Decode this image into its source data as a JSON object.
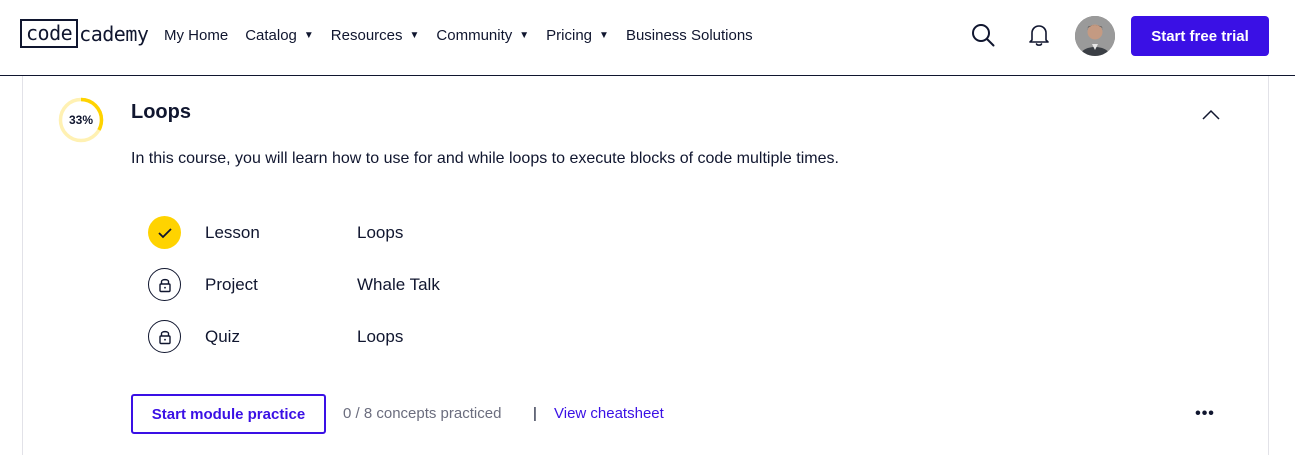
{
  "header": {
    "logo": {
      "part1": "code",
      "part2": "cademy"
    },
    "nav": [
      {
        "label": "My Home",
        "dropdown": false
      },
      {
        "label": "Catalog",
        "dropdown": true
      },
      {
        "label": "Resources",
        "dropdown": true
      },
      {
        "label": "Community",
        "dropdown": true
      },
      {
        "label": "Pricing",
        "dropdown": true
      },
      {
        "label": "Business Solutions",
        "dropdown": false
      }
    ],
    "icons": {
      "search": "search-icon",
      "notifications": "bell-icon"
    },
    "trial_label": "Start free trial"
  },
  "module": {
    "progress_label": "33%",
    "progress_fraction": 0.33,
    "title": "Loops",
    "description": "In this course, you will learn how to use for and while loops to execute blocks of code multiple times.",
    "items": [
      {
        "type": "Lesson",
        "name": "Loops",
        "status": "completed"
      },
      {
        "type": "Project",
        "name": "Whale Talk",
        "status": "locked"
      },
      {
        "type": "Quiz",
        "name": "Loops",
        "status": "locked"
      }
    ],
    "practice_label": "Start module practice",
    "concepts_text": "0 / 8 concepts practiced",
    "separator": "|",
    "cheatsheet_label": "View cheatsheet",
    "more_symbol": "•••"
  },
  "colors": {
    "brand_primary": "#3a10e5",
    "navy": "#10162f",
    "yellow": "#ffd300",
    "progress_track": "#fff1b3",
    "muted_text": "#6b6d7e"
  }
}
